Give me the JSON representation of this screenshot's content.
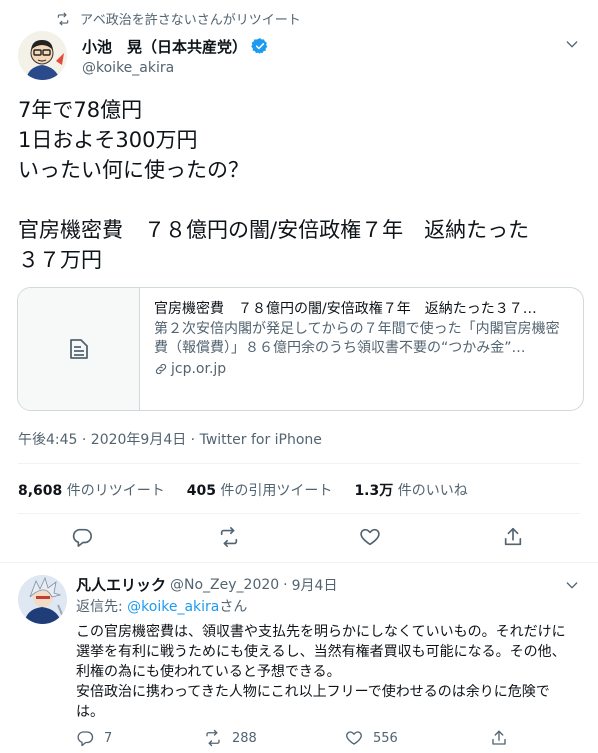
{
  "retweet_context": "アベ政治を許さないさんがリツイート",
  "tweet": {
    "display_name": "小池　晃（日本共産党）",
    "handle": "@koike_akira",
    "text_lines": [
      "7年で78億円",
      "1日およそ300万円",
      "いったい何に使ったの？",
      "",
      "官房機密費　７８億円の闇/安倍政権７年　返納たった",
      "３７万円"
    ],
    "card": {
      "title": "官房機密費　７８億円の闇/安倍政権７年　返納たった３７…",
      "description": "第２次安倍内閣が発足してからの７年間で使った「内閣官房機密費（報償費）」８６億円余のうち領収書不要の“つかみ金”…",
      "domain": "jcp.or.jp"
    },
    "timestamp": "午後4:45 · 2020年9月4日 · Twitter for iPhone",
    "stats": {
      "retweets_count": "8,608",
      "retweets_label": " 件のリツイート",
      "quotes_count": "405",
      "quotes_label": " 件の引用ツイート",
      "likes_count": "1.3万",
      "likes_label": " 件のいいね"
    }
  },
  "reply": {
    "display_name": "凡人エリック",
    "handle": "@No_Zey_2020",
    "separator": "·",
    "date": "9月4日",
    "replying_prefix": "返信先: ",
    "replying_to": "@koike_akira",
    "replying_suffix": "さん",
    "text": "この官房機密費は、領収書や支払先を明らかにしなくていいもの。それだけに選挙を有利に戦うためにも使えるし、当然有権者買収も可能になる。その他、利権の為にも使われていると予想できる。\n安倍政治に携わってきた人物にこれ以上フリーで使わせるのは余りに危険では。",
    "reply_count": "7",
    "retweet_count": "288",
    "like_count": "556"
  },
  "colors": {
    "accent": "#1d9bf0",
    "text": "#0f1419",
    "muted": "#536471",
    "border": "#cfd9de"
  },
  "icons": [
    "retweet-icon",
    "verified-badge-icon",
    "caret-down-icon",
    "document-icon",
    "link-icon",
    "reply-icon",
    "like-icon",
    "share-icon"
  ]
}
